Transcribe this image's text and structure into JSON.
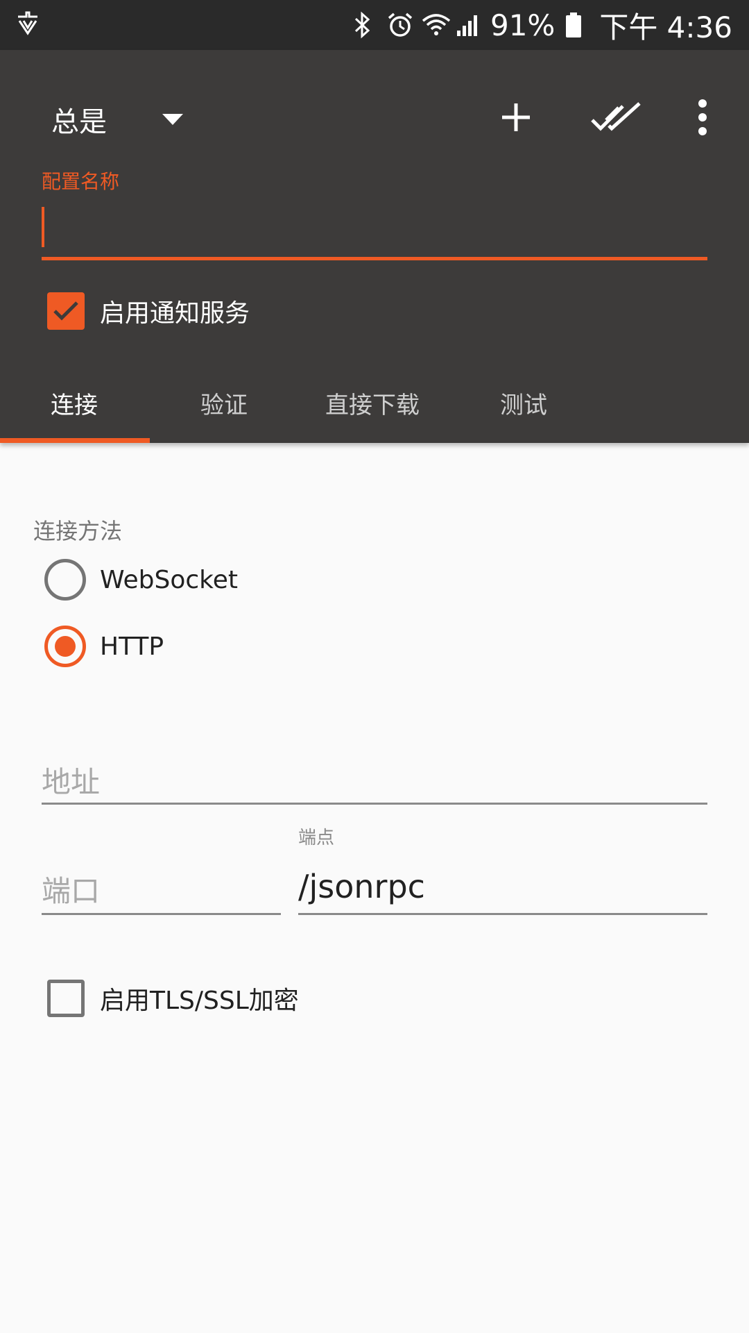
{
  "status_bar": {
    "battery": "91%",
    "time": "下午 4:36",
    "icons": [
      "download-icon",
      "bluetooth-icon",
      "alarm-icon",
      "wifi-icon",
      "signal-icon",
      "battery-icon"
    ]
  },
  "toolbar": {
    "spinner_value": "总是",
    "icons": [
      "dropdown-arrow-icon",
      "add-icon",
      "done-all-icon",
      "more-vert-icon"
    ]
  },
  "profile": {
    "name_label": "配置名称",
    "name_value": "",
    "notify_label": "启用通知服务",
    "notify_checked": true
  },
  "tabs": [
    {
      "label": "连接",
      "active": true
    },
    {
      "label": "验证",
      "active": false
    },
    {
      "label": "直接下载",
      "active": false
    },
    {
      "label": "测试",
      "active": false
    }
  ],
  "connection": {
    "method_label": "连接方法",
    "options": [
      {
        "label": "WebSocket",
        "selected": false
      },
      {
        "label": "HTTP",
        "selected": true
      }
    ],
    "address_placeholder": "地址",
    "port_placeholder": "端口",
    "endpoint_label": "端点",
    "endpoint_value": "/jsonrpc",
    "tls_label": "启用TLS/SSL加密",
    "tls_checked": false
  },
  "colors": {
    "accent": "#ef5a24",
    "header_bg": "#3d3b3a",
    "status_bg": "#2a2a2a",
    "content_bg": "#fafafa"
  }
}
